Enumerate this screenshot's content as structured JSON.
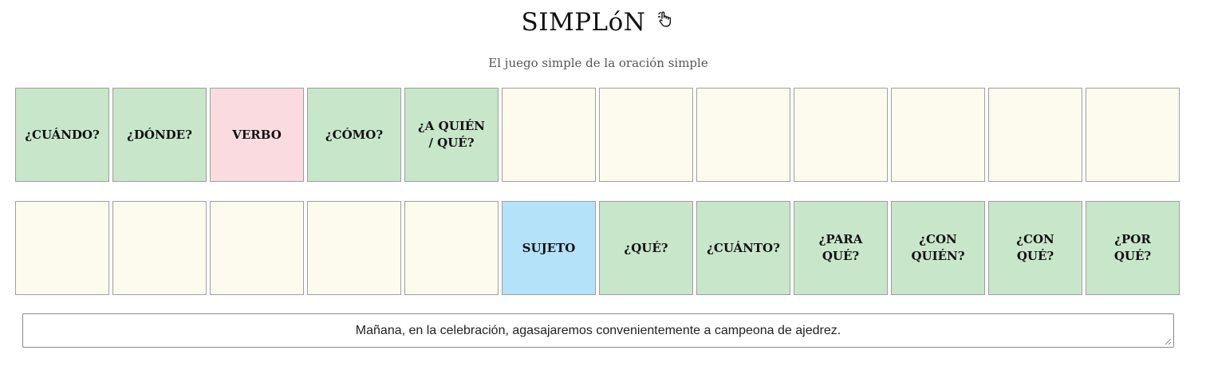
{
  "header": {
    "title": "SIMPLóN",
    "subtitle": "El juego simple de la oración simple",
    "title_icon": "pointing-hand-icon"
  },
  "colors": {
    "complement": "#c8e6c9",
    "verb": "#f9dbe0",
    "subject": "#b3e2f9",
    "empty": "#fdfbee"
  },
  "board": {
    "top_row": [
      {
        "label": "¿CUÁNDO?",
        "type": "complement"
      },
      {
        "label": "¿DÓNDE?",
        "type": "complement"
      },
      {
        "label": "VERBO",
        "type": "verb"
      },
      {
        "label": "¿CÓMO?",
        "type": "complement"
      },
      {
        "label": "¿A QUIÉN / QUÉ?",
        "type": "complement"
      },
      {
        "label": "",
        "type": "empty"
      },
      {
        "label": "",
        "type": "empty"
      },
      {
        "label": "",
        "type": "empty"
      },
      {
        "label": "",
        "type": "empty"
      },
      {
        "label": "",
        "type": "empty"
      },
      {
        "label": "",
        "type": "empty"
      },
      {
        "label": "",
        "type": "empty"
      }
    ],
    "bottom_row": [
      {
        "label": "",
        "type": "empty"
      },
      {
        "label": "",
        "type": "empty"
      },
      {
        "label": "",
        "type": "empty"
      },
      {
        "label": "",
        "type": "empty"
      },
      {
        "label": "",
        "type": "empty"
      },
      {
        "label": "SUJETO",
        "type": "subject"
      },
      {
        "label": "¿QUÉ?",
        "type": "complement"
      },
      {
        "label": "¿CUÁNTO?",
        "type": "complement"
      },
      {
        "label": "¿PARA QUÉ?",
        "type": "complement"
      },
      {
        "label": "¿CON QUIÉN?",
        "type": "complement"
      },
      {
        "label": "¿CON QUÉ?",
        "type": "complement"
      },
      {
        "label": "¿POR QUÉ?",
        "type": "complement"
      }
    ]
  },
  "sentence": {
    "text": "Mañana, en la celebración, agasajaremos convenientemente a campeona de ajedrez."
  }
}
